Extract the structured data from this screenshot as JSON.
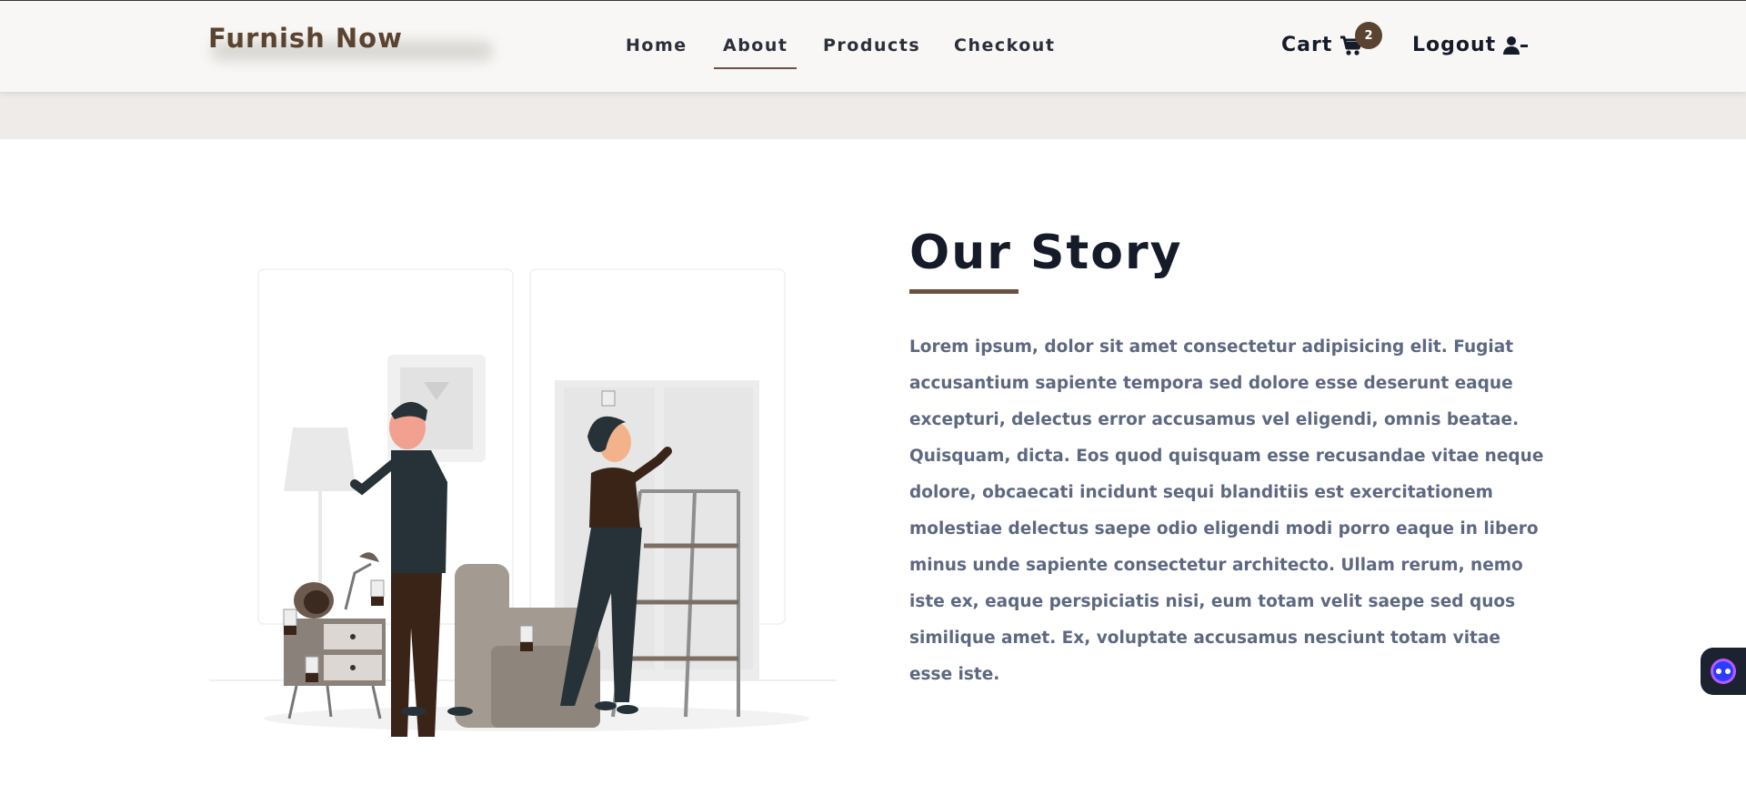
{
  "brand": {
    "name": "Furnish Now"
  },
  "nav": {
    "links": [
      {
        "label": "Home"
      },
      {
        "label": "About"
      },
      {
        "label": "Products"
      },
      {
        "label": "Checkout"
      }
    ],
    "active": "About"
  },
  "cart": {
    "label": "Cart",
    "count": "2"
  },
  "account": {
    "logout_label": "Logout"
  },
  "story": {
    "title": "Our Story",
    "body": "Lorem ipsum, dolor sit amet consectetur adipisicing elit. Fugiat accusantium sapiente tempora sed dolore esse deserunt eaque excepturi, delectus error accusamus vel eligendi, omnis beatae. Quisquam, dicta. Eos quod quisquam esse recusandae vitae neque dolore, obcaecati incidunt sequi blanditiis est exercitationem molestiae delectus saepe odio eligendi modi porro eaque in libero minus unde sapiente consectetur architecto. Ullam rerum, nemo iste ex, eaque perspiciatis nisi, eum totam velit saepe sed quos similique amet. Ex, voluptate accusamus nesciunt totam vitae esse iste."
  },
  "illustration": {
    "icon": "furniture-shopping-illustration",
    "price_tag_symbol": "$"
  },
  "colors": {
    "brand": "#5a4330",
    "accent": "#6b5240",
    "text_dark": "#151b29",
    "text_body": "#5e6880",
    "nav_bg": "#f8f7f5",
    "band_bg": "#efebe8"
  }
}
